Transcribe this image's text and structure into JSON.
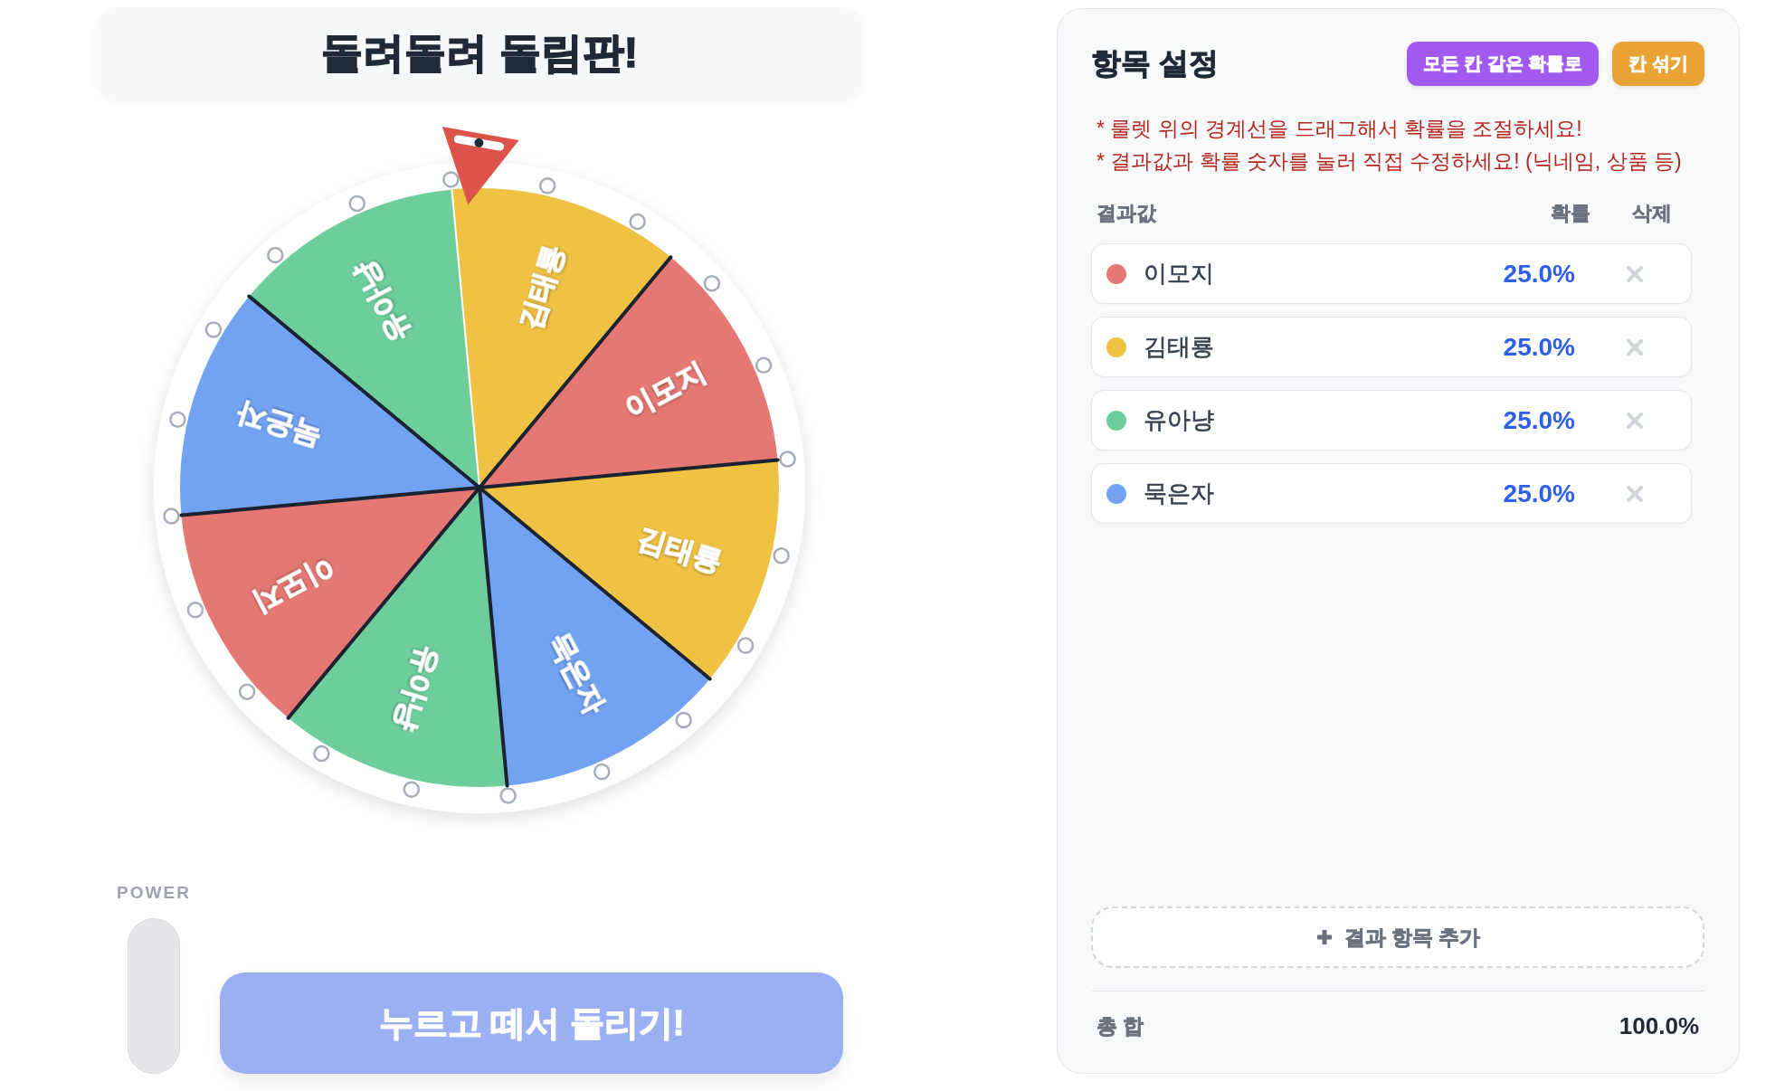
{
  "title": "돌려돌려 돌림판!",
  "wheel": {
    "segments": [
      {
        "label": "김태룡",
        "color": "#f0c244"
      },
      {
        "label": "이모지",
        "color": "#e57873"
      },
      {
        "label": "김태룡",
        "color": "#f0c244"
      },
      {
        "label": "묵은자",
        "color": "#72a3f3"
      },
      {
        "label": "유아냥",
        "color": "#6dce9b"
      },
      {
        "label": "이모지",
        "color": "#e57873"
      },
      {
        "label": "묵은자",
        "color": "#72a3f3"
      },
      {
        "label": "유아냥",
        "color": "#6dce9b"
      }
    ]
  },
  "power": {
    "label": "POWER"
  },
  "spin_button": {
    "label": "누르고 떼서 돌리기!"
  },
  "settings_panel": {
    "title": "항목 설정",
    "buttons": [
      {
        "label": "모든 칸 같은 확률로",
        "kind": "equalize"
      },
      {
        "label": "칸 섞기",
        "kind": "shuffle"
      }
    ],
    "notes": [
      "* 룰렛 위의 경계선을 드래그해서 확률을 조절하세요!",
      "* 결과값과 확률 숫자를 눌러 직접 수정하세요! (닉네임, 상품 등)"
    ],
    "columns": [
      "결과값",
      "확률",
      "삭제"
    ],
    "items": [
      {
        "name": "이모지",
        "probability": "25.0%",
        "color": "#e57873"
      },
      {
        "name": "김태룡",
        "probability": "25.0%",
        "color": "#f0c244"
      },
      {
        "name": "유아냥",
        "probability": "25.0%",
        "color": "#6dce9b"
      },
      {
        "name": "묵은자",
        "probability": "25.0%",
        "color": "#72a3f3"
      }
    ],
    "add_button": {
      "label": "결과 항목 추가"
    },
    "total": {
      "label": "총 합",
      "value": "100.0%"
    }
  }
}
